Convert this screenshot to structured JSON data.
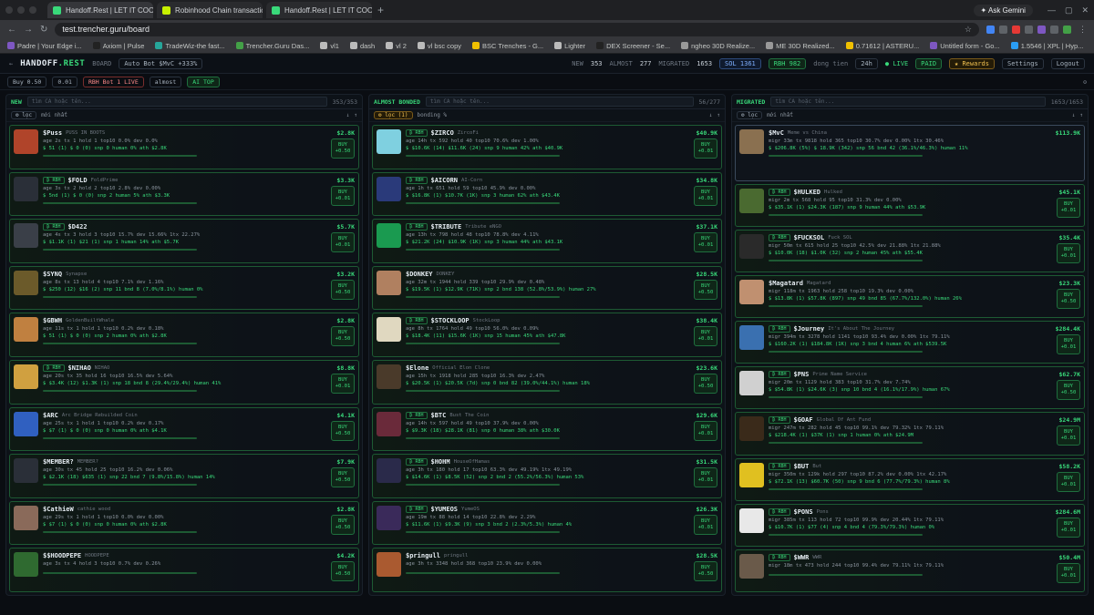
{
  "browser": {
    "tabs": [
      {
        "title": "Handoff.Rest | LET IT COOK",
        "active": true,
        "color": "#39d97a"
      },
      {
        "title": "Robinhood Chain transaction",
        "active": false,
        "color": "#c7f000"
      },
      {
        "title": "Handoff.Rest | LET IT COOK",
        "active": false,
        "color": "#39d97a"
      }
    ],
    "gemini_label": "Ask Gemini",
    "url": "test.trencher.guru/board",
    "bookmarks": [
      "Padre | Your Edge i...",
      "Axiom | Pulse",
      "TradeWiz-the fast...",
      "Trencher.Guru Das...",
      "vl1",
      "dash",
      "vl 2",
      "vl bsc copy",
      "BSC Trenches - G...",
      "Lighter",
      "DEX Screener - Se...",
      "ngheo 30D Realize...",
      "ME 30D Realized...",
      "0.71612 | ASTERU...",
      "Untitled form - Go...",
      "1.5546 | XPL | Hyp..."
    ],
    "all_bookmarks": "All Bookmarks"
  },
  "app": {
    "logo_main": "HANDOFF",
    "logo_tld": ".REST",
    "section": "BOARD",
    "autobot": "Auto Bot $MvC +333%",
    "stats": {
      "new_label": "NEW",
      "new": "353",
      "almost_label": "ALMOST",
      "almost": "277",
      "migrated_label": "MIGRATED",
      "migrated": "1653"
    },
    "sol": "SOL 1361",
    "rbh": "RBH 982",
    "range_label": "dong tien",
    "range": "24h",
    "live": "LIVE",
    "paid": "PAID",
    "rewards": "Rewards",
    "settings": "Settings",
    "logout": "Logout"
  },
  "toolbar": {
    "buy": "Buy 0.50",
    "sell": "0.01",
    "bot": "RBH Bot 1 LIVE",
    "almost": "almost",
    "ai": "AI TOP"
  },
  "columns": [
    {
      "title": "NEW",
      "search": "tìm CA hoặc tên...",
      "count": "353/353",
      "sort": "mới nhất",
      "filter": "lọc",
      "cards": [
        {
          "tkr": "$Puss",
          "name": "PUSS IN BOOTS",
          "mc": "$2.8K",
          "stats": "age 2s tx 1 hold 1 top10 0.0% dev 0.0%",
          "sub": "$ 51 (1) $ 0 (0)  snp 0  human 0%  ath $2.8K",
          "buy": "+0.50",
          "c": "#b0442a",
          "rbh": false
        },
        {
          "tkr": "$FOLD",
          "name": "FoldPrime",
          "mc": "$3.3K",
          "stats": "age 3s tx 2 hold 2 top10 2.8% dev 0.00%",
          "sub": "$ 5nd (1) $ 0 (0)  snp 2  human 5%  ath $3.3K",
          "buy": "+0.01",
          "c": "#2a2f38",
          "rbh": true
        },
        {
          "tkr": "$D422",
          "name": "",
          "mc": "$5.7K",
          "stats": "age 4s tx 3 hold 3 top10 15.7% dev 15.66% 1tx 22.27%",
          "sub": "$ $1.1K (1) $21 (1)  snp 1  human 14%  ath $5.7K",
          "buy": "+0.01",
          "c": "#3a3f48",
          "rbh": true
        },
        {
          "tkr": "$SYNQ",
          "name": "Synapse",
          "mc": "$3.2K",
          "stats": "age 8s tx 13 hold 4 top10 7.1% dev 1.16%",
          "sub": "$ $250 (12) $16 (2)  snp 11  bnd 8 (7.0%/8.1%)  human 0%",
          "buy": "+0.50",
          "c": "#6b5a2a",
          "rbh": false
        },
        {
          "tkr": "$GBWH",
          "name": "GoldenBuiltWhale",
          "mc": "$2.8K",
          "stats": "age 11s tx 1 hold 1 top10 0.2% dev 0.18%",
          "sub": "$ 51 (1) $ 0 (0)  snp 2  human 0%  ath $2.8K",
          "buy": "+0.50",
          "c": "#c08040",
          "rbh": false
        },
        {
          "tkr": "$NIHAO",
          "name": "NIHAO",
          "mc": "$8.8K",
          "stats": "age 20s tx 35 hold 16 top10 16.5% dev 5.64%",
          "sub": "$ $3.4K (12) $1.3K (1)  snp 18  bnd 8 (29.4%/29.4%)  human 41%",
          "buy": "+0.01",
          "c": "#d0a040",
          "rbh": true
        },
        {
          "tkr": "$ARC",
          "name": "Arc Bridge Rebuilded Coin",
          "mc": "$4.1K",
          "stats": "age 25s tx 1 hold 1 top10 0.2% dev 0.17%",
          "sub": "$ $7 (1) $ 0 (0)  snp 0  human 0%  ath $4.1K",
          "buy": "+0.50",
          "c": "#3060c0",
          "rbh": false
        },
        {
          "tkr": "$MEMBER?",
          "name": "MEMBER?",
          "mc": "$7.9K",
          "stats": "age 30s tx 45 hold 25 top10 16.2% dev 0.06%",
          "sub": "$ $2.1K (18) $635 (1)  snp 22  bnd 7 (9.8%/15.8%)  human 14%",
          "buy": "+0.50",
          "c": "#2a2f38",
          "rbh": false
        },
        {
          "tkr": "$CathieW",
          "name": "cathie wood",
          "mc": "$2.8K",
          "stats": "age 29s tx 1 hold 1 top10 0.0% dev 0.00%",
          "sub": "$ $7 (1) $ 0 (0)  snp 0  human 0%  ath $2.8K",
          "buy": "+0.50",
          "c": "#8a6a5a",
          "rbh": false
        },
        {
          "tkr": "$$HOODPEPE",
          "name": "HOODPEPE",
          "mc": "$4.2K",
          "stats": "age 3s tx 4 hold 3 top10 0.7% dev 0.26%",
          "sub": "",
          "buy": "+0.50",
          "c": "#2f6a30",
          "rbh": false
        }
      ]
    },
    {
      "title": "ALMOST BONDED",
      "search": "tìm CA hoặc tên...",
      "count": "56/277",
      "sort": "bonding %",
      "filter": "lọc (1)",
      "cards": [
        {
          "tkr": "$ZIRCO",
          "name": "ZircoFi",
          "mc": "$40.9K",
          "stats": "age 14h tx 592 hold 40 top10 70.6% dev 1.00%",
          "sub": "$ $10.6K (14) $11.6K (24)  snp 9  human 42%  ath $40.9K",
          "buy": "+0.01",
          "c": "#7fd0e0",
          "rbh": true
        },
        {
          "tkr": "$AICORN",
          "name": "AI-Corn",
          "mc": "$34.8K",
          "stats": "age 1h tx 651 hold 59 top10 45.9% dev 0.00%",
          "sub": "$ $16.8K (1) $10.7K (1K)  snp 3  human 62%  ath $43.4K",
          "buy": "+0.01",
          "c": "#2a3a7a",
          "rbh": true
        },
        {
          "tkr": "$TRIBUTE",
          "name": "Tribute eNGO",
          "mc": "$37.1K",
          "stats": "age 13h tx 798 hold 48 top10 78.8% dev 4.11%",
          "sub": "$ $21.2K (24) $10.9K (1K)  snp 3  human 44%  ath $43.1K",
          "buy": "+0.01",
          "c": "#1a9a50",
          "rbh": true
        },
        {
          "tkr": "$DONKEY",
          "name": "DONKEY",
          "mc": "$28.5K",
          "stats": "age 32m tx 1944 hold 339 top10 29.9% dev 0.48%",
          "sub": "$ $19.5K (1) $12.9K (71K)  snp 2  bnd 138 (52.8%/53.9%)  human 27%",
          "buy": "+0.50",
          "c": "#b08060",
          "rbh": false
        },
        {
          "tkr": "$STOCKLOOP",
          "name": "StockLoop",
          "mc": "$38.4K",
          "stats": "age 8h tx 1764 hold 49 top10 56.0% dev 0.09%",
          "sub": "$ $18.4K (11) $15.6K (1K)  snp 15  human 45%  ath $47.8K",
          "buy": "+0.01",
          "c": "#e0d8c0",
          "rbh": true
        },
        {
          "tkr": "$Elone",
          "name": "Official Elon Clone",
          "mc": "$23.6K",
          "stats": "age 15h tx 1918 hold 285 top10 16.3% dev 2.47%",
          "sub": "$ $20.5K (1) $20.5K (7d)  snp 0  bnd 82 (39.0%/44.1%)  human 18%",
          "buy": "+0.50",
          "c": "#4a3a2a",
          "rbh": false
        },
        {
          "tkr": "$BTC",
          "name": "Bust The Coin",
          "mc": "$29.6K",
          "stats": "age 14h tx 597 hold 49 top10 37.9% dev 0.00%",
          "sub": "$ $9.3K (18) $28.1K (81)  snp 0  human 38%  ath $30.0K",
          "buy": "+0.01",
          "c": "#6a2a3a",
          "rbh": true
        },
        {
          "tkr": "$HOHM",
          "name": "HouseOfHamas",
          "mc": "$31.5K",
          "stats": "age 3h tx 180 hold 17 top10 63.3% dev 49.19% 1tx 49.19%",
          "sub": "$ $14.6K (1) $8.5K (52)  snp 2  bnd 2 (55.2%/56.3%)  human 53%",
          "buy": "+0.01",
          "c": "#2a2a4a",
          "rbh": true
        },
        {
          "tkr": "$YUMEOS",
          "name": "YumeOS",
          "mc": "$26.3K",
          "stats": "age 19m tx 88 hold 14 top10 22.8% dev 2.29%",
          "sub": "$ $11.6K (1) $9.3K (9)  snp 3  bnd 2 (2.3%/5.3%)  human 4%",
          "buy": "+0.01",
          "c": "#3a2a5a",
          "rbh": true
        },
        {
          "tkr": "$pringull",
          "name": "pringull",
          "mc": "$28.5K",
          "stats": "age 3h tx 3348 hold 368 top10 23.9% dev 0.00%",
          "sub": "",
          "buy": "+0.50",
          "c": "#aa5a30",
          "rbh": false
        }
      ]
    },
    {
      "title": "MIGRATED",
      "search": "tìm CA hoặc tên...",
      "count": "1653/1653",
      "sort": "mới nhất",
      "filter": "lọc",
      "cards": [
        {
          "tkr": "$MvC",
          "name": "Meme vs China",
          "mc": "$113.9K",
          "stats": "migr 33m tx 9818 hold 365 top10 30.7% dev 0.00% 1tx 30.46%",
          "sub": "$ $206.8K (5%) $ 18.9K (342)  snp 56  bnd 42 (36.1%/46.3%)  human 11%",
          "buy": "",
          "c": "#8a7050",
          "rbh": false
        },
        {
          "tkr": "$HULKED",
          "name": "Hulked",
          "mc": "$45.1K",
          "stats": "migr 2m tx 568 hold 95 top10 31.3% dev 0.00%",
          "sub": "$ $35.1K (1) $24.3K (187)  snp 9  human 44%  ath $53.9K",
          "buy": "+0.01",
          "c": "#4a6a30",
          "rbh": true
        },
        {
          "tkr": "$FUCKSOL",
          "name": "Fuck SOL",
          "mc": "$35.4K",
          "stats": "migr 50m tx 615 hold 25 top10 42.5% dev 21.88% 1tx 21.88%",
          "sub": "$ $10.0K (18) $1.0K (32)  snp 2  human 45%  ath $55.4K",
          "buy": "+0.01",
          "c": "#2a2a2a",
          "rbh": true
        },
        {
          "tkr": "$Magatard",
          "name": "Magatard",
          "mc": "$23.3K",
          "stats": "migr 118m tx 1963 hold 258 top10 19.3% dev 0.00%",
          "sub": "$ $13.8K (1) $57.8K (897)  snp 49  bnd 85 (67.7%/132.0%)  human 26%",
          "buy": "+0.50",
          "c": "#c09070",
          "rbh": false
        },
        {
          "tkr": "$Journey",
          "name": "It's About The Journey",
          "mc": "$284.4K",
          "stats": "migr 394m tx 3278 hold 1141 top10 93.4% dev 0.00% 1tx 79.11%",
          "sub": "$ $160.2K (1) $184.8K (1K)  snp 3  bnd 4  human 6%  ath $539.5K",
          "buy": "+0.01",
          "c": "#3a70b0",
          "rbh": true
        },
        {
          "tkr": "$PNS",
          "name": "Prime Name Service",
          "mc": "$62.7K",
          "stats": "migr 20m tx 1129 hold 383 top10 31.7% dev 7.74%",
          "sub": "$ $54.8K (1) $24.6K (3)  snp 10  bnd 4 (16.1%/17.9%)  human 67%",
          "buy": "+0.50",
          "c": "#d0d0d0",
          "rbh": true
        },
        {
          "tkr": "$GOAF",
          "name": "Global Of Ant Fund",
          "mc": "$24.9M",
          "stats": "migr 247m tx 282 hold 45 top10 99.1% dev 79.32% 1tx 79.11%",
          "sub": "$ $218.4K (1) $37K (1)  snp 1  human 0%  ath $24.9M",
          "buy": "+0.01",
          "c": "#3a2a1a",
          "rbh": true
        },
        {
          "tkr": "$BUT",
          "name": "But",
          "mc": "$58.2K",
          "stats": "migr 350m tx 129k hold 297 top10 87.2% dev 0.00% 1tx 42.17%",
          "sub": "$ $72.1K (13) $60.7K (50)  snp 9  bnd 6 (77.7%/79.3%)  human 8%",
          "buy": "+0.01",
          "c": "#e0c020",
          "rbh": true
        },
        {
          "tkr": "$PONS",
          "name": "Pons",
          "mc": "$284.6M",
          "stats": "migr 385m tx 113 hold 72 top10 99.9% dev 20.44% 1tx 79.11%",
          "sub": "$ $10.7K (1) $77 (4)  snp 4  bnd 4 (79.3%/79.3%)  human 0%",
          "buy": "+0.01",
          "c": "#e8e8e8",
          "rbh": true
        },
        {
          "tkr": "$WWR",
          "name": "WWR",
          "mc": "$50.4M",
          "stats": "migr 18m tx 473 hold 244 top10 99.4% dev 79.11% 1tx 79.11%",
          "sub": "",
          "buy": "+0.01",
          "c": "#6a5a4a",
          "rbh": true
        }
      ]
    }
  ],
  "colors": {
    "accent": "#39d97a",
    "bg": "#0a0d12",
    "danger": "#f85149"
  }
}
